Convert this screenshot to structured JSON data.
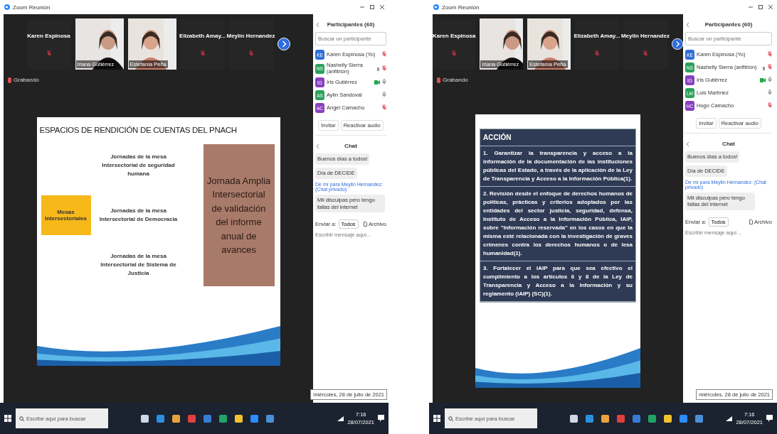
{
  "windows": [
    {
      "title": "Zoom Reunión",
      "strip": [
        {
          "kind": "name",
          "label": "Karen Espinosa"
        },
        {
          "kind": "video",
          "label": "Iriana Gutiérrez"
        },
        {
          "kind": "video",
          "label": "Estefanía Peña"
        },
        {
          "kind": "name",
          "label": "Elizabeth Amay..."
        },
        {
          "kind": "name",
          "label": "Meylin Hernandez"
        }
      ],
      "recording": "Grabando",
      "slide": {
        "kind": "diagram",
        "title": "ESPACIOS DE RENDICIÓN DE CUENTAS DEL PNACH",
        "hub": "Mesas Intersectoriales",
        "branches": [
          "Jornadas de la mesa Intersectorial de seguridad humana",
          "Jornadas de la mesa Intersectorial de Democracia",
          "Jornadas de la mesa Intersectorial de Sistema de Justicia"
        ],
        "result": "Jornada Amplia Intersectorial de validación del informe anual de avances"
      },
      "participants": {
        "title": "Participantes (60)",
        "search_placeholder": "Buscar un participante",
        "items": [
          {
            "initials": "KE",
            "name": "Karen Espinosa (Yo)",
            "color": "#2f6fd8",
            "hand": false,
            "video": false,
            "muted": true
          },
          {
            "initials": "NS",
            "name": "Nashelly Sierra (anfitrión)",
            "color": "#2aa15a",
            "hand": true,
            "video": false,
            "muted": true
          },
          {
            "initials": "IG",
            "name": "Iris Gutiérrez",
            "color": "#8a3fc0",
            "hand": false,
            "video": true,
            "muted": false
          },
          {
            "initials": "AS",
            "name": "Aylin Sandoval",
            "color": "#2aa15a",
            "hand": false,
            "video": false,
            "muted": false
          },
          {
            "initials": "AC",
            "name": "Angel Camacho",
            "color": "#8a3fc0",
            "hand": false,
            "video": false,
            "muted": true
          }
        ],
        "buttons": [
          "Invitar",
          "Reactivar audio"
        ]
      },
      "chat": {
        "title": "Chat",
        "messages": [
          {
            "kind": "bubble",
            "text": "Buenos días a todos!"
          },
          {
            "kind": "bubble",
            "text": "Día de DECIDE"
          },
          {
            "kind": "meta",
            "text": "De mí para Meylin Hernandez: (Chat privado)"
          },
          {
            "kind": "bubble",
            "text": "Mil disculpas pero tengo fallas del internet"
          }
        ],
        "send_to_label": "Enviar a:",
        "send_to": "Todos",
        "file": "Archivo",
        "placeholder": "Escribir mensaje aquí..."
      },
      "date_tip": "miércoles, 28 de julio de 2021",
      "taskbar": {
        "search_placeholder": "Escribe aquí para buscar",
        "time": "7:16",
        "date": "28/07/2021"
      }
    },
    {
      "title": "Zoom Reunión",
      "strip": [
        {
          "kind": "name",
          "label": "Karen Espinosa"
        },
        {
          "kind": "video",
          "label": "Iriana Gutiérrez"
        },
        {
          "kind": "video",
          "label": "Estefanía Peña"
        },
        {
          "kind": "name",
          "label": "Elizabeth Amay..."
        },
        {
          "kind": "name",
          "label": "Meylin Hernandez"
        }
      ],
      "recording": "Grabando",
      "slide": {
        "kind": "text",
        "heading": "ACCIÓN",
        "paragraphs": [
          "1. Garantizar la transparencia y acceso a la información de la documentación de las instituciones públicas del Estado, a través de la aplicación de la Ley de Transparencia y Acceso a la Información Pública(1).",
          "2. Revisión desde el enfoque de derechos humanos de políticas, prácticas y criterios adoptados por las entidades del sector justicia, seguridad, defensa, Instituto de Acceso a la Información Pública, IAIP, sobre \"Información reservada\" en los casos en que la misma esté relacionada con la investigación de graves crímenes contra los derechos humanos o de lesa humanidad(1).",
          "3. Fortalecer el IAIP para que sea efectivo el cumplimiento a los artículos 6 y 8 de la Ley de Transparencia y Acceso a la Información y su reglamento (IAIP) (SC)(1)."
        ]
      },
      "participants": {
        "title": "Participantes (60)",
        "search_placeholder": "Buscar un participante",
        "items": [
          {
            "initials": "KE",
            "name": "Karen Espinosa (Yo)",
            "color": "#2f6fd8",
            "hand": false,
            "video": false,
            "muted": true
          },
          {
            "initials": "NS",
            "name": "Nashelly Sierra (anfitrión)",
            "color": "#2aa15a",
            "hand": true,
            "video": false,
            "muted": true
          },
          {
            "initials": "IG",
            "name": "Iris Gutiérrez",
            "color": "#8a3fc0",
            "hand": false,
            "video": true,
            "muted": false
          },
          {
            "initials": "LM",
            "name": "Luis Martínez",
            "color": "#2aa15a",
            "hand": false,
            "video": false,
            "muted": false
          },
          {
            "initials": "HC",
            "name": "Hugo Camacho",
            "color": "#8a3fc0",
            "hand": false,
            "video": false,
            "muted": true
          }
        ],
        "buttons": [
          "Invitar",
          "Reactivar audio"
        ]
      },
      "chat": {
        "title": "Chat",
        "messages": [
          {
            "kind": "bubble",
            "text": "Buenos días a todos!"
          },
          {
            "kind": "bubble",
            "text": "Día de DECIDE"
          },
          {
            "kind": "meta",
            "text": "De mí para Meylin Hernandez: (Chat privado)"
          },
          {
            "kind": "bubble",
            "text": "Mil disculpas pero tengo fallas del internet"
          }
        ],
        "send_to_label": "Enviar a:",
        "send_to": "Todos",
        "file": "Archivo",
        "placeholder": "Escribir mensaje aquí..."
      },
      "date_tip": "miércoles, 28 de julio de 2021",
      "taskbar": {
        "search_placeholder": "Escribe aquí para buscar",
        "time": "7:16",
        "date": "28/07/2021"
      }
    }
  ]
}
